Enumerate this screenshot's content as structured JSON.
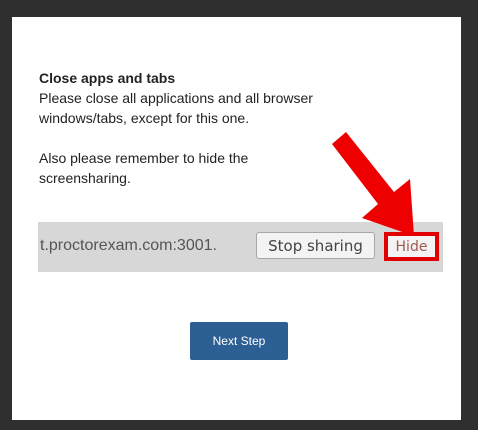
{
  "modal": {
    "title": "Close apps and tabs",
    "line1": "Please close all applications and all browser",
    "line2": "windows/tabs, except for this one.",
    "line3": "Also please remember to hide the",
    "line4": "screensharing."
  },
  "share_bar": {
    "host": "t.proctorexam.com:3001.",
    "stop_label": "Stop sharing",
    "hide_label": "Hide"
  },
  "next_button": {
    "label": "Next Step"
  },
  "colors": {
    "accent": "#2c5f94",
    "highlight": "#e00000"
  },
  "annotation": {
    "icon": "red-arrow-icon"
  }
}
